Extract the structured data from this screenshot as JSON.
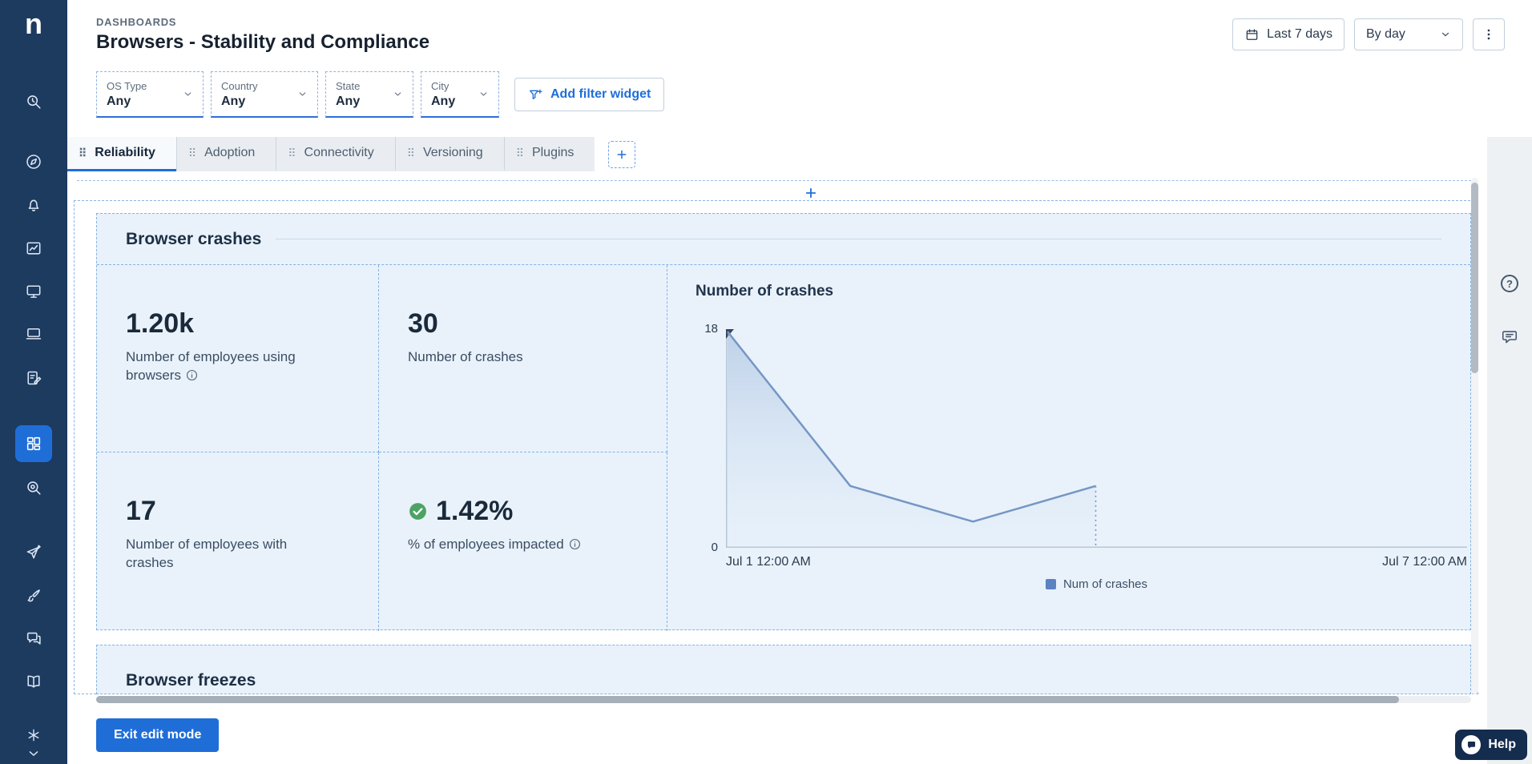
{
  "sidebar": {
    "logo": "n",
    "items": [
      {
        "icon": "history-search-icon"
      },
      {
        "icon": "compass-icon"
      },
      {
        "icon": "bell-icon"
      },
      {
        "icon": "chart-frame-icon"
      },
      {
        "icon": "monitor-icon"
      },
      {
        "icon": "devices-icon"
      },
      {
        "icon": "survey-edit-icon"
      },
      {
        "icon": "dashboard-grid-icon",
        "active": true
      },
      {
        "icon": "investigate-icon"
      },
      {
        "icon": "paper-plane-icon"
      },
      {
        "icon": "paint-brush-icon"
      },
      {
        "icon": "chat-bubbles-icon"
      },
      {
        "icon": "book-icon"
      },
      {
        "icon": "asterisk-gear-icon"
      },
      {
        "icon": "chevron-down-icon"
      }
    ]
  },
  "header": {
    "breadcrumb": "DASHBOARDS",
    "title": "Browsers - Stability and Compliance",
    "date_range_label": "Last 7 days",
    "granularity_value": "By day"
  },
  "filter_bar": {
    "widgets": [
      {
        "label": "OS Type",
        "value": "Any"
      },
      {
        "label": "Country",
        "value": "Any"
      },
      {
        "label": "State",
        "value": "Any"
      },
      {
        "label": "City",
        "value": "Any"
      }
    ],
    "add_filter_label": "Add filter widget"
  },
  "tabs": {
    "items": [
      {
        "label": "Reliability",
        "active": true
      },
      {
        "label": "Adoption",
        "active": false
      },
      {
        "label": "Connectivity",
        "active": false
      },
      {
        "label": "Versioning",
        "active": false
      },
      {
        "label": "Plugins",
        "active": false
      }
    ]
  },
  "dashboard": {
    "sections": [
      {
        "title": "Browser crashes"
      },
      {
        "title": "Browser freezes"
      }
    ],
    "metrics": [
      {
        "value": "1.20k",
        "label": "Number of employees using browsers",
        "has_info": true
      },
      {
        "value": "30",
        "label": "Number of crashes",
        "has_info": false
      },
      {
        "value": "17",
        "label": "Number of employees with crashes",
        "has_info": false
      },
      {
        "value": "1.42%",
        "label": "% of employees impacted",
        "has_info": true,
        "status_icon": "check-circle-icon"
      }
    ]
  },
  "chart_data": {
    "type": "line",
    "title": "Number of crashes",
    "series": [
      {
        "name": "Num of crashes",
        "x_day_index": [
          0,
          1,
          2,
          3
        ],
        "values": [
          18,
          5,
          2,
          5
        ]
      }
    ],
    "x_days_span": 7,
    "x_labels_visible": [
      "Jul 1 12:00 AM",
      "Jul 7 12:00 AM"
    ],
    "ylim": [
      0,
      18
    ],
    "y_ticks_visible": [
      18,
      0
    ],
    "grid": false,
    "legend_position": "bottom-center",
    "line_color": "#7596c4",
    "area_fill": true,
    "last_point_dotted_dropline": true
  },
  "edit_mode": {
    "exit_button_label": "Exit edit mode"
  },
  "help_launcher": {
    "label": "Help",
    "icon": "chat-icon"
  },
  "glyphs": {
    "grip": "⠿",
    "question": "?"
  },
  "colors": {
    "sidebar_bg": "#1d3a5f",
    "accent_blue": "#1f6ed8",
    "edit_dash_blue": "#85b2e2",
    "widget_bg": "#e9f2fb",
    "success_green": "#4ca364",
    "chart_line": "#7596c4",
    "legend_swatch": "#5b82c1"
  }
}
